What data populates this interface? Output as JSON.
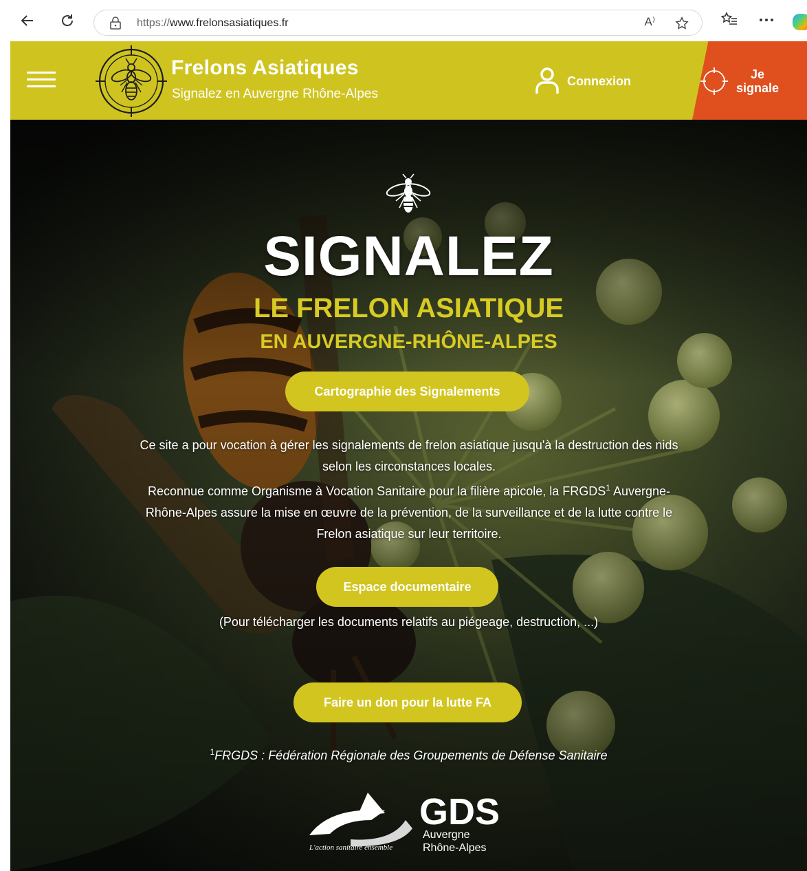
{
  "browser": {
    "url_scheme": "https://",
    "url_host": "www.frelonsasiatiques.fr",
    "read_aloud": "A⁾"
  },
  "header": {
    "brand_title": "Frelons Asiatiques",
    "brand_subtitle": "Signalez en Auvergne Rhône-Alpes",
    "login_label": "Connexion",
    "report_line1": "Je",
    "report_line2": "signale",
    "colors": {
      "bar": "#cfc41f",
      "report": "#e0501e"
    }
  },
  "hero": {
    "headline": "SIGNALEZ",
    "subtitle1": "LE FRELON ASIATIQUE",
    "subtitle2": "EN AUVERGNE-RHÔNE-ALPES",
    "map_button": "Cartographie des Signalements",
    "intro_line1": "Ce site a pour vocation à gérer les signalements de frelon asiatique jusqu'à la destruction des nids selon les circonstances locales.",
    "intro_line2a": "Reconnue comme Organisme à Vocation Sanitaire pour la filière apicole, la FRGDS",
    "intro_sup": "1",
    "intro_line2b": " Auvergne-Rhône-Alpes assure la mise en œuvre de la prévention, de la surveillance et de la lutte contre le Frelon asiatique sur leur territoire.",
    "docs_button": "Espace documentaire",
    "docs_note": "(Pour télécharger les documents relatifs au piégeage, destruction, ...)",
    "donate_button": "Faire un don pour la lutte FA",
    "footnote_sup": "1",
    "footnote_text": "FRGDS : Fédération Régionale des Groupements de Défense Sanitaire",
    "colors": {
      "accent": "#d7cb24",
      "button": "#d2c520"
    }
  },
  "gds_logo": {
    "wordmark": "GDS",
    "region_line1": "Auvergne",
    "region_line2": "Rhône-Alpes",
    "tagline": "L'action sanitaire ensemble"
  }
}
